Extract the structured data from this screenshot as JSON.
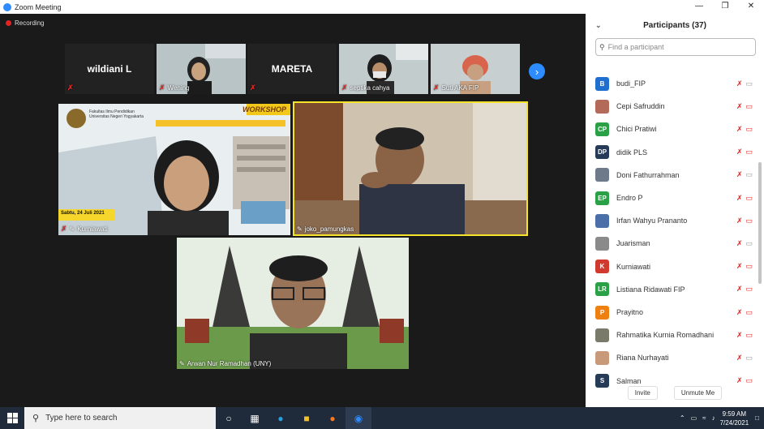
{
  "window": {
    "title": "Zoom Meeting"
  },
  "recording": {
    "label": "Recording"
  },
  "strip": {
    "tiles": [
      {
        "name": "wildiani L",
        "kind": "name"
      },
      {
        "name": "Wening",
        "kind": "video"
      },
      {
        "name": "MARETA",
        "kind": "name"
      },
      {
        "name": "septika cahya",
        "kind": "video"
      },
      {
        "name": "Suti AKA FIP",
        "kind": "video"
      }
    ]
  },
  "main": {
    "tiles": [
      {
        "name": "Kurniawati",
        "banner_title": "WORKSHOP",
        "banner_org": "Fakultas Ilmu Pendidikan Universitas Negeri Yogyakarta",
        "banner_date": "Sabtu, 24 Juli 2021"
      },
      {
        "name": "joko_pamungkas"
      },
      {
        "name": "Arwan Nur Ramadhan (UNY)"
      }
    ]
  },
  "participants": {
    "title": "Participants (37)",
    "search_placeholder": "Find a participant",
    "list": [
      {
        "initials": "B",
        "name": "budi_FIP",
        "color": "#1f6fd1",
        "video": "on"
      },
      {
        "initials": "",
        "name": "Cepi Safruddin",
        "color": "#b36a58",
        "video": "off"
      },
      {
        "initials": "CP",
        "name": "Chici Pratiwi",
        "color": "#2aa047",
        "video": "off"
      },
      {
        "initials": "DP",
        "name": "didik PLS",
        "color": "#263b58",
        "video": "off"
      },
      {
        "initials": "",
        "name": "Doni Fathurrahman",
        "color": "#6e7a8a",
        "video": "on"
      },
      {
        "initials": "EP",
        "name": "Endro P",
        "color": "#2aa047",
        "video": "off"
      },
      {
        "initials": "",
        "name": "Irfan Wahyu Prananto",
        "color": "#4b6fa8",
        "video": "off"
      },
      {
        "initials": "",
        "name": "Juarisman",
        "color": "#8a8a8a",
        "video": "on"
      },
      {
        "initials": "K",
        "name": "Kurniawati",
        "color": "#d0392b",
        "video": "off"
      },
      {
        "initials": "LR",
        "name": "Listiana Ridawati FIP",
        "color": "#2aa047",
        "video": "off"
      },
      {
        "initials": "P",
        "name": "Prayitno",
        "color": "#f07f11",
        "video": "off"
      },
      {
        "initials": "",
        "name": "Rahmatika Kurnia Romadhani",
        "color": "#7a7a6a",
        "video": "off"
      },
      {
        "initials": "",
        "name": "Riana Nurhayati",
        "color": "#c99a7a",
        "video": "on"
      },
      {
        "initials": "S",
        "name": "Salman",
        "color": "#263b58",
        "video": "off"
      }
    ],
    "invite": "Invite",
    "unmute": "Unmute Me"
  },
  "taskbar": {
    "search_placeholder": "Type here to search",
    "time": "9:59 AM",
    "date": "7/24/2021"
  },
  "colors": {
    "accent": "#2d8cff",
    "active_speaker_border": "#f5e42b",
    "muted": "#e02424"
  }
}
